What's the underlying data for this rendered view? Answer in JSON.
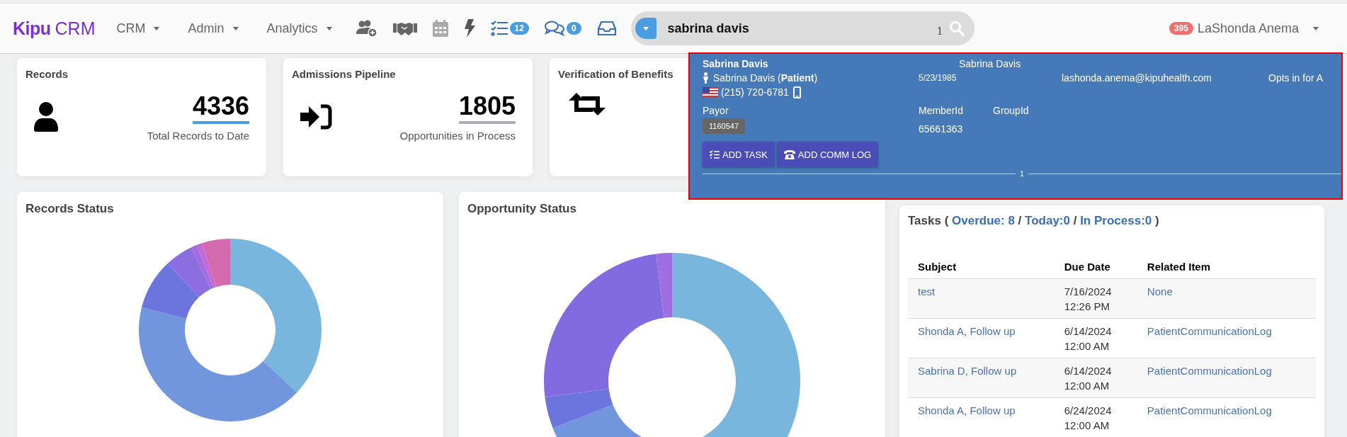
{
  "navbar": {
    "logo": {
      "brand": "Kipu",
      "product": "CRM"
    },
    "menus": [
      {
        "label": "CRM"
      },
      {
        "label": "Admin"
      },
      {
        "label": "Analytics"
      }
    ],
    "icon_badges": {
      "tasks": "12",
      "messages": "0"
    },
    "search": {
      "value": "sabrina davis",
      "count": "1"
    },
    "user": {
      "badge": "395",
      "name": "LaShonda Anema"
    }
  },
  "cards": [
    {
      "kind": "records",
      "title": "Records",
      "value": "4336",
      "caption": "Total Records to Date"
    },
    {
      "kind": "pipeline",
      "title": "Admissions Pipeline",
      "value": "1805",
      "caption": "Opportunities in Process"
    },
    {
      "kind": "benefits",
      "title": "Verification of Benefits"
    }
  ],
  "charts": [
    {
      "kind": "records",
      "title": "Records Status"
    },
    {
      "kind": "opportunity",
      "title": "Opportunity Status"
    }
  ],
  "tasks": {
    "lead": "Tasks (",
    "links": [
      "Overdue: 8",
      "Today:0",
      "In Process:0"
    ],
    "separators": [
      "/",
      "/"
    ],
    "close": ")",
    "columns": [
      "Subject",
      "Due Date",
      "Related Item"
    ],
    "rows": [
      {
        "subject": "test",
        "due_date": "7/16/2024",
        "due_time": "12:26 PM",
        "related": "None"
      },
      {
        "subject": "Shonda A, Follow up",
        "due_date": "6/14/2024",
        "due_time": "12:00 AM",
        "related": "PatientCommunicationLog"
      },
      {
        "subject": "Sabrina D, Follow up",
        "due_date": "6/14/2024",
        "due_time": "12:00 AM",
        "related": "PatientCommunicationLog"
      },
      {
        "subject": "Shonda A, Follow up",
        "due_date": "6/24/2024",
        "due_time": "12:00 AM",
        "related": "PatientCommunicationLog"
      }
    ]
  },
  "search_result": {
    "name": "Sabrina Davis",
    "name_2": "Sabrina Davis",
    "person": "Sabrina Davis (**Patient**)",
    "dob": "5/23/1985",
    "email": "lashonda.anema@kipuhealth.com",
    "opt_in": "Opts in for A",
    "phone": "(215) 720-6781",
    "payor_label": "Payor",
    "member_id_label": "MemberId",
    "group_id_label": "GroupId",
    "payor_badge": "1160547",
    "member_id": "65661363",
    "buttons": [
      {
        "kind": "task",
        "label": "ADD TASK"
      },
      {
        "kind": "comm",
        "label": "ADD COMM LOG"
      }
    ],
    "page": "1"
  }
}
